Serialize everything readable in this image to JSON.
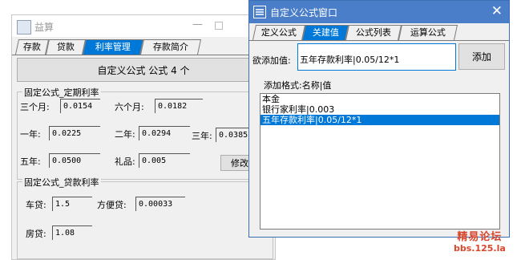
{
  "calc_window": {
    "title": "益算",
    "tabs": [
      "存款",
      "贷款",
      "利率管理",
      "存款简介"
    ],
    "active_tab": 2,
    "main_button": "自定义公式  公式 4 个",
    "deposit_group": {
      "title": "固定公式_定期利率",
      "fields": [
        {
          "label": "三个月:",
          "value": "0.0154"
        },
        {
          "label": "六个月:",
          "value": "0.0182"
        },
        {
          "label": "一年:",
          "value": "0.0225"
        },
        {
          "label": "二年:",
          "value": "0.0294"
        },
        {
          "label": "三年:",
          "value": "0.0385"
        },
        {
          "label": "五年:",
          "value": "0.0500"
        },
        {
          "label": "礼品:",
          "value": "0.005"
        }
      ],
      "modify_button": "修改"
    },
    "loan_group": {
      "title": "固定公式_贷款利率",
      "fields": [
        {
          "label": "车贷:",
          "value": "1.5"
        },
        {
          "label": "方便贷:",
          "value": "0.00033"
        },
        {
          "label": "房贷:",
          "value": "1.08"
        }
      ]
    }
  },
  "dialog": {
    "title": "自定义公式窗口",
    "tabs": [
      "定义公式",
      "关建值",
      "公式列表",
      "运算公式"
    ],
    "active_tab": 1,
    "input_label": "欲添加值:",
    "input_value": "五年存款利率|0.05/12*1",
    "add_button": "添加",
    "format_hint": "添加格式:名称|值",
    "list_items": [
      "本金",
      "银行家利率|0.003",
      "五年存款利率|0.05/12*1"
    ],
    "selected_index": 2
  },
  "watermark": {
    "line1": "精易论坛",
    "line2": "bbs.125.la"
  },
  "colors": {
    "accent": "#0078d7",
    "dialog_title": "#4a7ec9",
    "watermark": "#d9452b"
  }
}
